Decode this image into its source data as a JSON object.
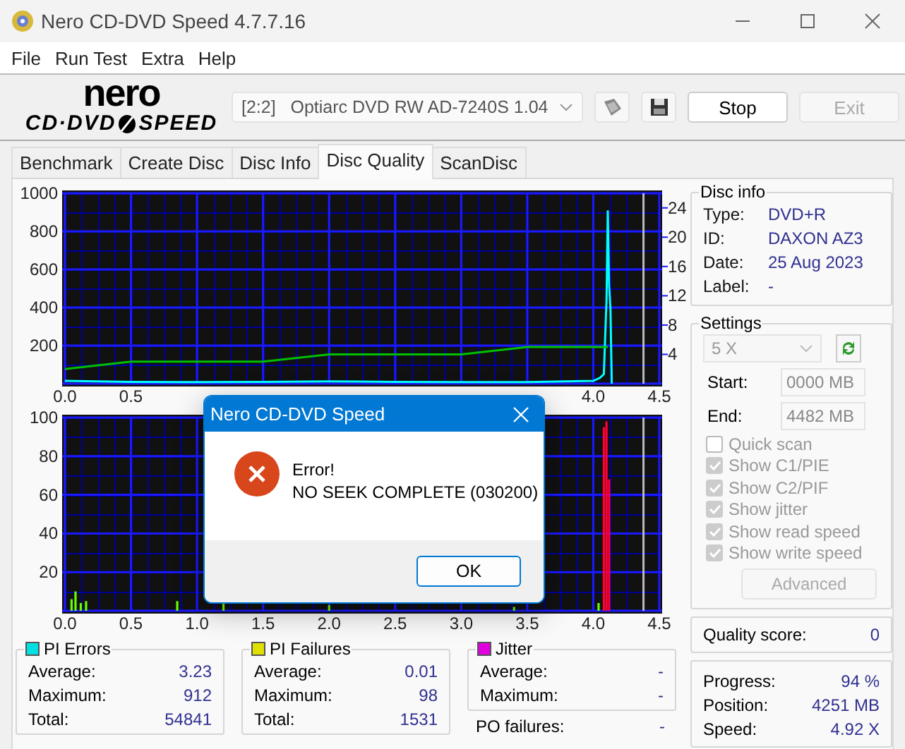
{
  "window": {
    "title": "Nero CD-DVD Speed 4.7.7.16"
  },
  "menu": [
    "File",
    "Run Test",
    "Extra",
    "Help"
  ],
  "logo": {
    "brand": "nero",
    "product_left": "CD·DVD",
    "product_right": "SPEED"
  },
  "toolbar": {
    "drive": "[2:2]   Optiarc DVD RW AD-7240S 1.04",
    "buttons": [
      {
        "label": "Stop",
        "disabled": false
      },
      {
        "label": "Exit",
        "disabled": true
      }
    ]
  },
  "tabs": [
    {
      "label": "Benchmark",
      "selected": false
    },
    {
      "label": "Create Disc",
      "selected": false
    },
    {
      "label": "Disc Info",
      "selected": false
    },
    {
      "label": "Disc Quality",
      "selected": true
    },
    {
      "label": "ScanDisc",
      "selected": false
    }
  ],
  "charts": [
    {
      "chart_data": {
        "type": "line",
        "x": [
          0.0,
          0.5,
          1.0,
          1.5,
          2.0,
          2.5,
          3.0,
          3.5,
          4.0,
          4.05,
          4.08,
          4.1,
          4.11,
          4.12,
          4.13,
          4.14
        ],
        "series": [
          {
            "color": "#00ffff",
            "values": [
              15,
              10,
              8,
              10,
              12,
              10,
              8,
              8,
              15,
              30,
              50,
              440,
              910,
              520,
              390,
              0
            ]
          },
          {
            "color": "#00c000",
            "axis": "y2",
            "values": [
              2,
              3,
              3,
              3,
              4,
              4,
              4,
              5,
              5,
              5,
              5,
              5,
              5,
              null,
              null,
              null
            ]
          }
        ],
        "xlim": [
          0,
          4.5
        ],
        "ylim": [
          0,
          1000
        ],
        "y2lim": [
          0,
          26
        ],
        "grid": true,
        "xticks": [
          {
            "value": 0,
            "label": "0.0"
          },
          {
            "value": 0.5,
            "label": "0.5"
          },
          {
            "value": 4,
            "label": "4.0"
          },
          {
            "value": 4.5,
            "label": "4.5"
          }
        ],
        "yticks": [
          200,
          400,
          600,
          800,
          1000
        ],
        "y2ticks": [
          4,
          8,
          12,
          16,
          20,
          24
        ],
        "ref_lines": [
          {
            "axis": "x",
            "value": 4.38
          }
        ]
      }
    },
    {
      "chart_data": {
        "type": "bar",
        "x": [
          0.05,
          0.08,
          0.12,
          0.16,
          0.85,
          1.2,
          2.0,
          3.4,
          4.04,
          4.08,
          4.1,
          4.12
        ],
        "series": [
          {
            "color": "#66ff00",
            "values": [
              6,
              10,
              4,
              5,
              5,
              4,
              3,
              2,
              4,
              null,
              null,
              null
            ]
          },
          {
            "color": "#ff0033",
            "values": [
              null,
              null,
              null,
              null,
              null,
              null,
              null,
              null,
              null,
              95,
              98,
              68
            ]
          }
        ],
        "xlim": [
          0,
          4.5
        ],
        "ylim": [
          0,
          100
        ],
        "grid": true,
        "xticks": [
          {
            "value": 0,
            "label": "0.0"
          },
          {
            "value": 0.5,
            "label": "0.5"
          },
          {
            "value": 1,
            "label": "1.0"
          },
          {
            "value": 1.5,
            "label": "1.5"
          },
          {
            "value": 2,
            "label": "2.0"
          },
          {
            "value": 2.5,
            "label": "2.5"
          },
          {
            "value": 3,
            "label": "3.0"
          },
          {
            "value": 3.5,
            "label": "3.5"
          },
          {
            "value": 4,
            "label": "4.0"
          },
          {
            "value": 4.5,
            "label": "4.5"
          }
        ],
        "yticks": [
          20,
          40,
          60,
          80,
          100
        ],
        "ref_lines": [
          {
            "axis": "x",
            "value": 4.38
          }
        ]
      }
    }
  ],
  "disc_info": {
    "title": "Disc info",
    "rows": [
      {
        "label": "Type:",
        "value": "DVD+R"
      },
      {
        "label": "ID:",
        "value": "DAXON AZ3"
      },
      {
        "label": "Date:",
        "value": "25 Aug 2023"
      },
      {
        "label": "Label:",
        "value": "-"
      }
    ]
  },
  "settings": {
    "title": "Settings",
    "speed": "5 X",
    "start": {
      "label": "Start:",
      "value": "0000 MB",
      "disabled": true
    },
    "end": {
      "label": "End:",
      "value": "4482 MB",
      "disabled": true
    },
    "options": [
      {
        "label": "Quick scan",
        "checked": false,
        "disabled": true
      },
      {
        "label": "Show C1/PIE",
        "checked": true,
        "disabled": true
      },
      {
        "label": "Show C2/PIF",
        "checked": true,
        "disabled": true
      },
      {
        "label": "Show jitter",
        "checked": true,
        "disabled": true
      },
      {
        "label": "Show read speed",
        "checked": true,
        "disabled": true
      },
      {
        "label": "Show write speed",
        "checked": true,
        "disabled": true
      }
    ],
    "advanced": {
      "label": "Advanced",
      "disabled": true
    }
  },
  "quality": {
    "label": "Quality score:",
    "value": "0"
  },
  "progress": [
    {
      "label": "Progress:",
      "value": "94 %"
    },
    {
      "label": "Position:",
      "value": "4251 MB"
    },
    {
      "label": "Speed:",
      "value": "4.92 X"
    }
  ],
  "stats": [
    {
      "title": "PI Errors",
      "color": "#00e0e0",
      "rows": [
        {
          "label": "Average:",
          "value": "3.23"
        },
        {
          "label": "Maximum:",
          "value": "912"
        },
        {
          "label": "Total:",
          "value": "54841"
        }
      ]
    },
    {
      "title": "PI Failures",
      "color": "#e0e000",
      "rows": [
        {
          "label": "Average:",
          "value": "0.01"
        },
        {
          "label": "Maximum:",
          "value": "98"
        },
        {
          "label": "Total:",
          "value": "1531"
        }
      ]
    },
    {
      "title": "Jitter",
      "color": "#e000e0",
      "rows": [
        {
          "label": "Average:",
          "value": "-"
        },
        {
          "label": "Maximum:",
          "value": "-"
        }
      ]
    }
  ],
  "po_failures": {
    "label": "PO failures:",
    "value": "-"
  },
  "dialog": {
    "title": "Nero CD-DVD Speed",
    "heading": "Error!",
    "message": "NO SEEK COMPLETE (030200)",
    "button": "OK"
  }
}
